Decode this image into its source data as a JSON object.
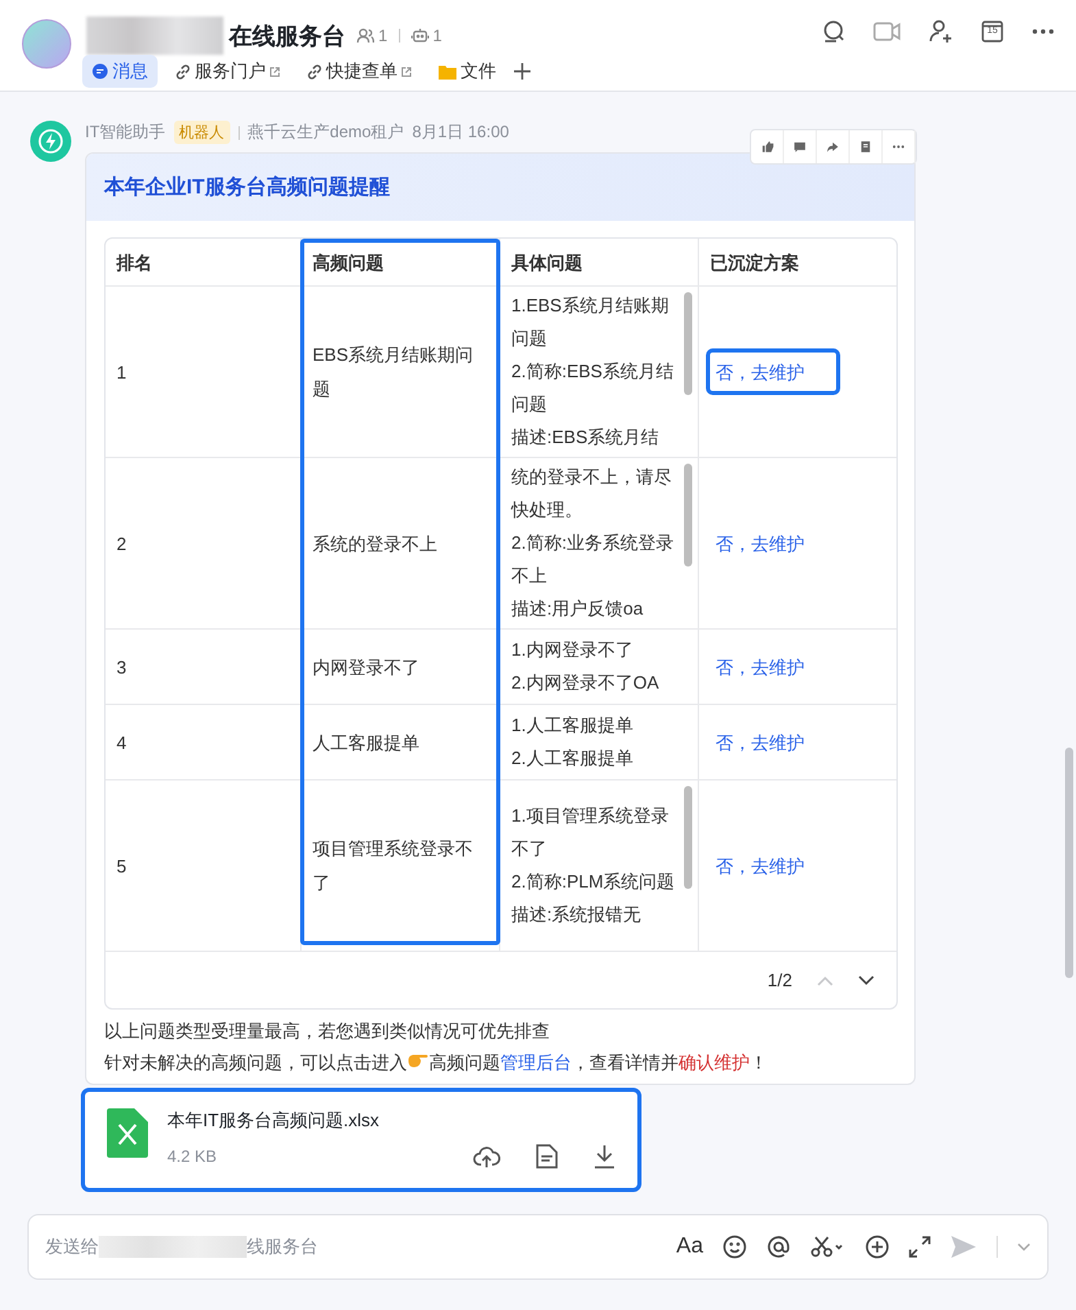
{
  "header": {
    "title": "在线服务台",
    "member_count": "1",
    "bot_count": "1",
    "calendar_day": "15",
    "tabs": [
      {
        "label": "消息",
        "kind": "chat",
        "selected": true
      },
      {
        "label": "服务门户",
        "kind": "link",
        "selected": false
      },
      {
        "label": "快捷查单",
        "kind": "link",
        "selected": false
      },
      {
        "label": "文件",
        "kind": "folder",
        "selected": false
      }
    ]
  },
  "message": {
    "sender": "IT智能助手",
    "tag": "机器人",
    "org": "燕千云生产demo租户",
    "time": "8月1日 16:00",
    "card": {
      "title": "本年企业IT服务台高频问题提醒",
      "table": {
        "columns": [
          {
            "label": "排名",
            "highlighted": false
          },
          {
            "label": "高频问题",
            "highlighted": true
          },
          {
            "label": "具体问题",
            "highlighted": false
          },
          {
            "label": "已沉淀方案",
            "highlighted": false
          }
        ],
        "rows": [
          {
            "rank": "1",
            "issue": "EBS系统月结账期问题",
            "details": [
              "1.EBS系统月结账期问题",
              "2.简称:EBS系统月结问题",
              "描述:EBS系统月结"
            ],
            "scrollable": true,
            "solution": "否，去维护",
            "highlighted": true
          },
          {
            "rank": "2",
            "issue": "系统的登录不上",
            "details": [
              "统的登录不上，请尽快处理。",
              "2.简称:业务系统登录不上",
              "描述:用户反馈oa"
            ],
            "scrollable": true,
            "solution": "否，去维护",
            "highlighted": false
          },
          {
            "rank": "3",
            "issue": "内网登录不了",
            "details": [
              "1.内网登录不了",
              "2.内网登录不了OA"
            ],
            "scrollable": false,
            "solution": "否，去维护",
            "highlighted": false
          },
          {
            "rank": "4",
            "issue": "人工客服提单",
            "details": [
              "1.人工客服提单",
              "2.人工客服提单"
            ],
            "scrollable": false,
            "solution": "否，去维护",
            "highlighted": false
          },
          {
            "rank": "5",
            "issue": "项目管理系统登录不了",
            "details": [
              "1.项目管理系统登录不了",
              "2.简称:PLM系统问题",
              "描述:系统报错无"
            ],
            "scrollable": true,
            "solution": "否，去维护",
            "highlighted": false
          }
        ],
        "pagination": "1/2"
      },
      "notes": [
        [
          {
            "kind": "text",
            "text": "以上问题类型受理量最高，若您遇到类似情况可优先排查"
          }
        ],
        [
          {
            "kind": "text",
            "text": "针对未解决的高频问题，可以点击进入"
          },
          {
            "kind": "hand"
          },
          {
            "kind": "text",
            "text": "高频问题"
          },
          {
            "kind": "link",
            "text": "管理后台"
          },
          {
            "kind": "text",
            "text": "，查看详情并"
          },
          {
            "kind": "alert",
            "text": "确认维护"
          },
          {
            "kind": "text",
            "text": "！"
          }
        ]
      ]
    },
    "file": {
      "name": "本年IT服务台高频问题.xlsx",
      "size": "4.2 KB",
      "highlighted": true
    }
  },
  "compose": {
    "placeholder_start": "发送给",
    "placeholder_end": "线服务台",
    "format_label": "Aa"
  }
}
